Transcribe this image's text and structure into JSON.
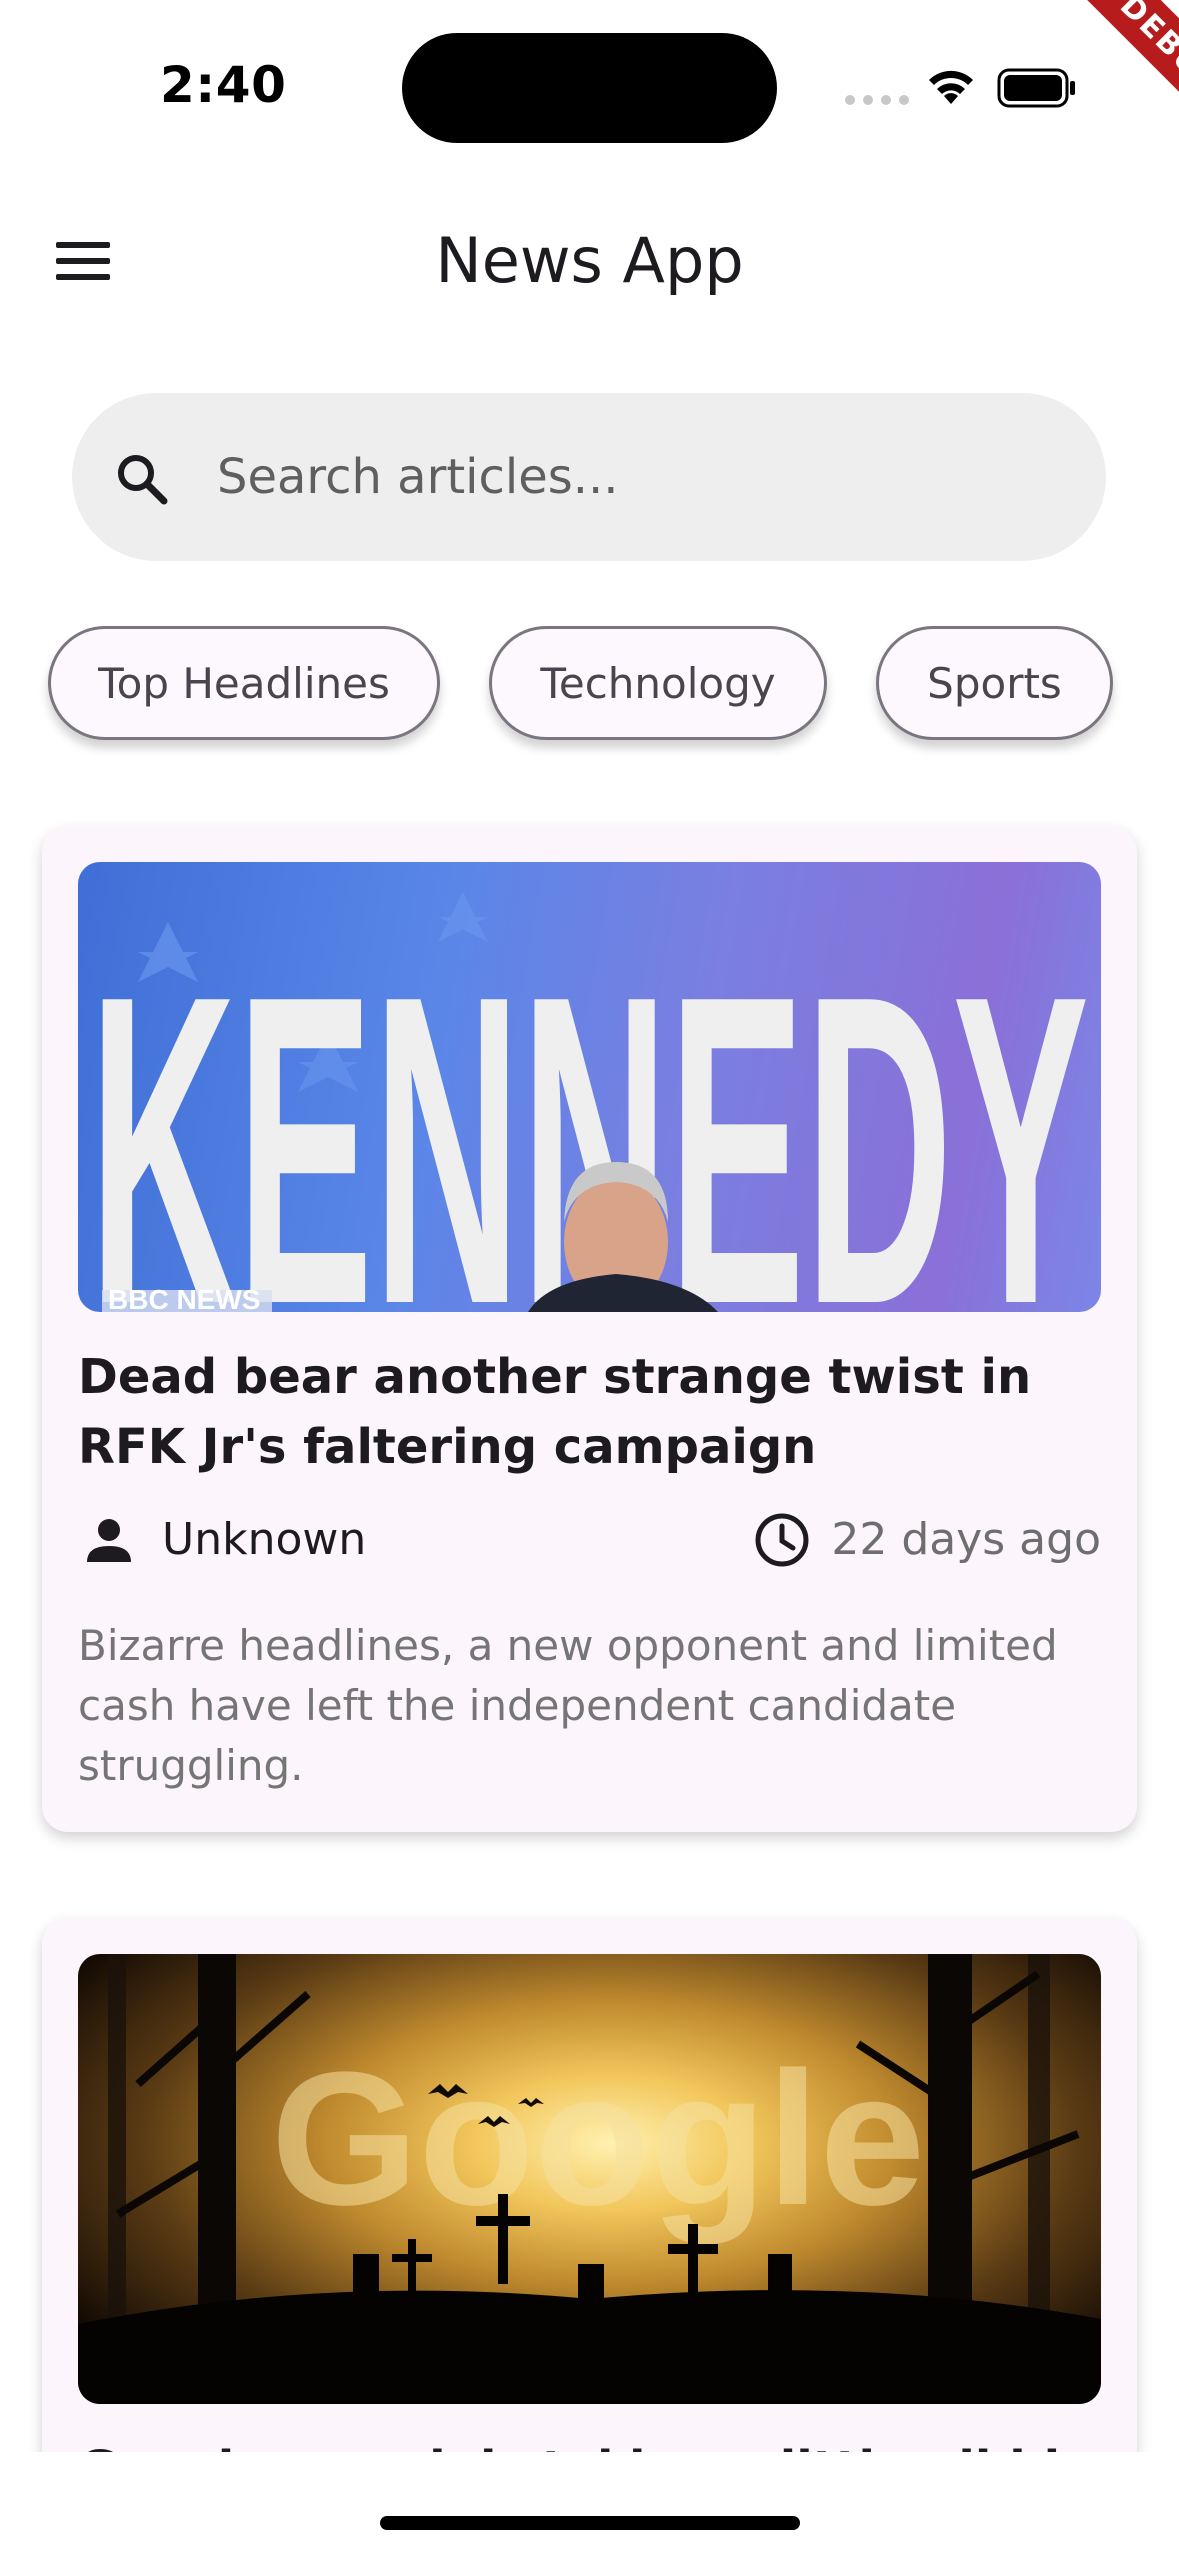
{
  "status_bar": {
    "time": "2:40"
  },
  "debug_banner": "DEBUG",
  "app_bar": {
    "title": "News App",
    "menu_icon": "hamburger-menu-icon"
  },
  "search": {
    "placeholder": "Search articles...",
    "value": "",
    "icon": "search-icon"
  },
  "categories": [
    {
      "label": "Top Headlines"
    },
    {
      "label": "Technology"
    },
    {
      "label": "Sports"
    }
  ],
  "articles": [
    {
      "image_text": "KENNEDY",
      "image_source_text": "BBC NEWS",
      "title": "Dead bear another strange twist in RFK Jr's faltering campaign",
      "author": "Unknown",
      "time_ago": "22 days ago",
      "description": "Bizarre headlines, a new opponent and limited cash have left the independent candidate struggling."
    },
    {
      "image_text": "Google",
      "title": "Google search is taking a little nibble this"
    }
  ],
  "colors": {
    "background": "#ffffff",
    "card": "#fcf5fc",
    "chip_bg": "#fdf7fe",
    "search_bg": "#eeeeee",
    "debug": "#b71c1c"
  }
}
